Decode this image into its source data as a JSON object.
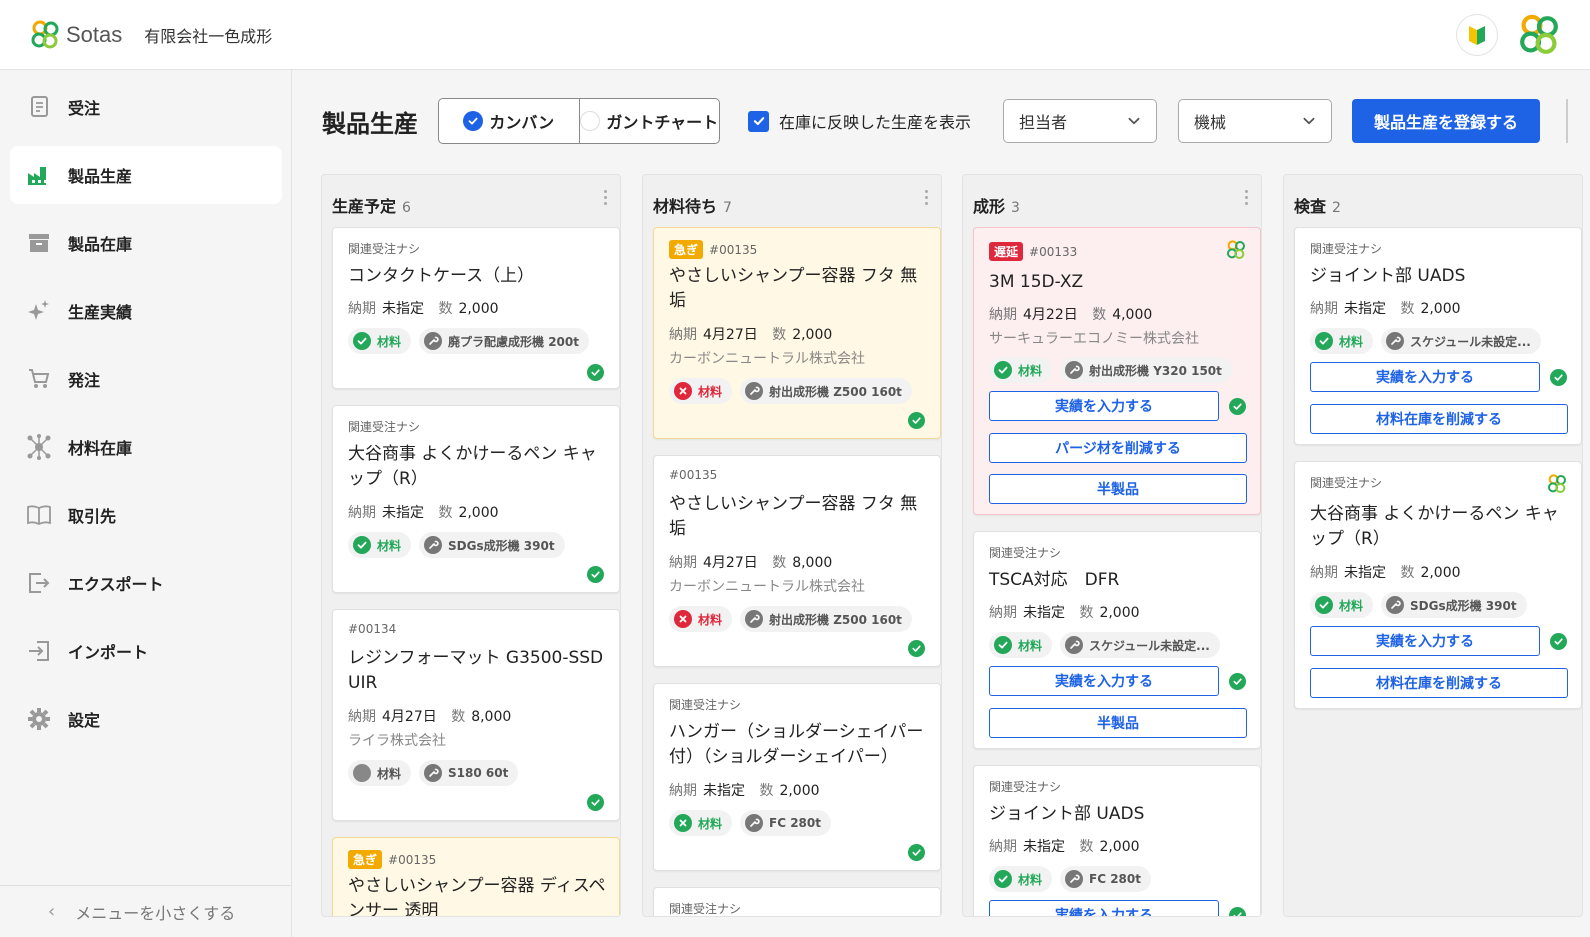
{
  "header": {
    "brand": "Sotas",
    "company": "有限会社一色成形"
  },
  "sidebar": {
    "items": [
      {
        "label": "受注",
        "icon": "document-icon"
      },
      {
        "label": "製品生産",
        "icon": "factory-icon"
      },
      {
        "label": "製品在庫",
        "icon": "archive-box-icon"
      },
      {
        "label": "生産実績",
        "icon": "sparkle-icon"
      },
      {
        "label": "発注",
        "icon": "cart-icon"
      },
      {
        "label": "材料在庫",
        "icon": "molecule-icon"
      },
      {
        "label": "取引先",
        "icon": "book-icon"
      },
      {
        "label": "エクスポート",
        "icon": "export-icon"
      },
      {
        "label": "インポート",
        "icon": "import-icon"
      },
      {
        "label": "設定",
        "icon": "gear-icon"
      }
    ],
    "collapse_label": "メニューを小さくする"
  },
  "toolbar": {
    "title": "製品生産",
    "view_kanban": "カンバン",
    "view_gantt": "ガントチャート",
    "stock_checkbox": "在庫に反映した生産を表示",
    "assignee": "担当者",
    "machine": "機械",
    "register_button": "製品生産を登録する"
  },
  "board": {
    "columns": [
      {
        "title": "生産予定",
        "count": "6",
        "cards": [
          {
            "top": "関連受注ナシ",
            "title": "コンタクトケース（上）",
            "due_label": "納期",
            "due": "未指定",
            "qty_label": "数",
            "qty": "2,000",
            "material": "材料",
            "machine": "廃プラ配慮成形機 200t"
          },
          {
            "top": "関連受注ナシ",
            "title": "大谷商事 よくかけーるペン キャップ（R）",
            "due_label": "納期",
            "due": "未指定",
            "qty_label": "数",
            "qty": "2,000",
            "material": "材料",
            "machine": "SDGs成形機 390t"
          },
          {
            "top": "#00134",
            "title": "レジンフォーマット G3500-SSD UIR",
            "due_label": "納期",
            "due": "4月27日",
            "qty_label": "数",
            "qty": "8,000",
            "company": "ライラ株式会社",
            "material": "材料",
            "machine": "S180 60t"
          },
          {
            "badge": "急ぎ",
            "top": "#00135",
            "title": "やさしいシャンプー容器 ディスペンサー 透明"
          }
        ]
      },
      {
        "title": "材料待ち",
        "count": "7",
        "cards": [
          {
            "badge": "急ぎ",
            "top": "#00135",
            "title": "やさしいシャンプー容器 フタ 無垢",
            "due_label": "納期",
            "due": "4月27日",
            "qty_label": "数",
            "qty": "2,000",
            "company": "カーボンニュートラル株式会社",
            "material": "材料",
            "machine": "射出成形機 Z500 160t"
          },
          {
            "top": "#00135",
            "title": "やさしいシャンプー容器 フタ 無垢",
            "due_label": "納期",
            "due": "4月27日",
            "qty_label": "数",
            "qty": "8,000",
            "company": "カーボンニュートラル株式会社",
            "material": "材料",
            "machine": "射出成形機 Z500 160t"
          },
          {
            "top": "関連受注ナシ",
            "title": "ハンガー（ショルダーシェイパー付）（ショルダーシェイパー）",
            "due_label": "納期",
            "due": "未指定",
            "qty_label": "数",
            "qty": "2,000",
            "material": "材料",
            "machine": "FC 280t"
          },
          {
            "top": "関連受注ナシ"
          }
        ]
      },
      {
        "title": "成形",
        "count": "3",
        "cards": [
          {
            "badge": "遅延",
            "top": "#00133",
            "title": "3M 15D-XZ",
            "due_label": "納期",
            "due": "4月22日",
            "qty_label": "数",
            "qty": "4,000",
            "company": "サーキュラーエコノミー株式会社",
            "material": "材料",
            "machine": "射出成形機 Y320 150t",
            "btn1": "実績を入力する",
            "btn2": "パージ材を削減する",
            "btn3": "半製品"
          },
          {
            "top": "関連受注ナシ",
            "title": "TSCA対応　DFR",
            "due_label": "納期",
            "due": "未指定",
            "qty_label": "数",
            "qty": "2,000",
            "material": "材料",
            "machine": "スケジュール未設定...",
            "btn1": "実績を入力する",
            "btn2": "半製品"
          },
          {
            "top": "関連受注ナシ",
            "title": "ジョイント部 UADS",
            "due_label": "納期",
            "due": "未指定",
            "qty_label": "数",
            "qty": "2,000",
            "material": "材料",
            "machine": "FC 280t",
            "btn1": "実績を入力する"
          }
        ]
      },
      {
        "title": "検査",
        "count": "2",
        "cards": [
          {
            "top": "関連受注ナシ",
            "title": "ジョイント部 UADS",
            "due_label": "納期",
            "due": "未指定",
            "qty_label": "数",
            "qty": "2,000",
            "material": "材料",
            "machine": "スケジュール未設定...",
            "btn1": "実績を入力する",
            "btn2": "材料在庫を削減する"
          },
          {
            "top": "関連受注ナシ",
            "title": "大谷商事 よくかけーるペン キャップ（R）",
            "due_label": "納期",
            "due": "未指定",
            "qty_label": "数",
            "qty": "2,000",
            "material": "材料",
            "machine": "SDGs成形機 390t",
            "btn1": "実績を入力する",
            "btn2": "材料在庫を削減する"
          }
        ]
      }
    ]
  },
  "colors": {
    "primary": "#1e63e6",
    "success": "#23a85a",
    "danger": "#e0283c",
    "warning": "#f2a900"
  }
}
